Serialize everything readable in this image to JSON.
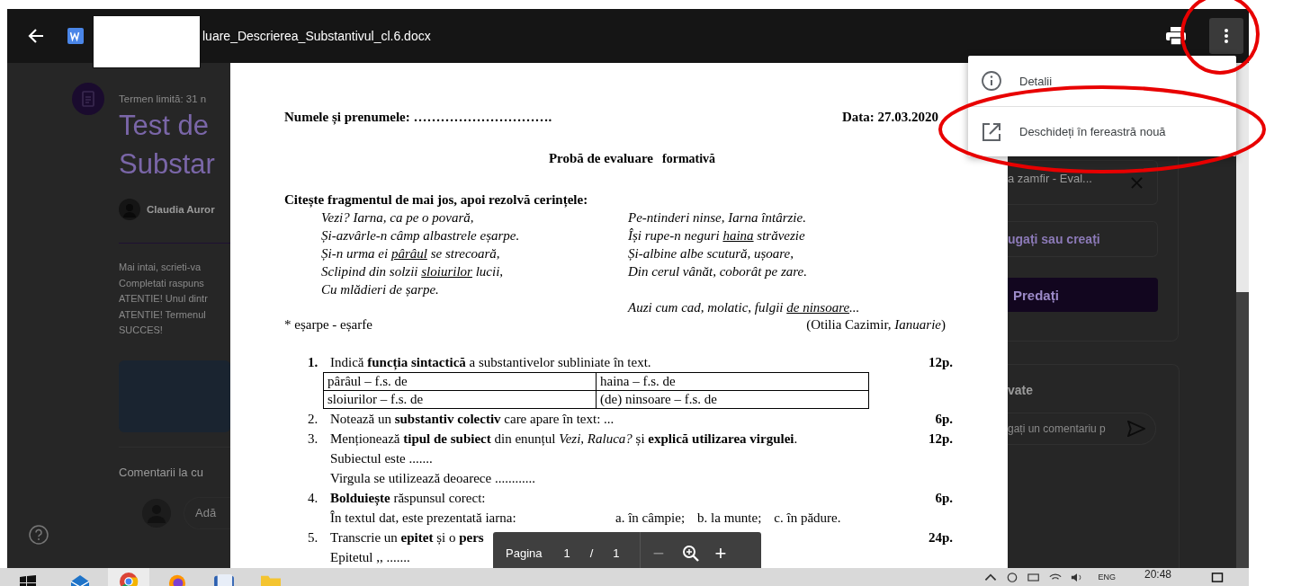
{
  "top_bar": {
    "title": "luare_Descrierea_Substantivul_cl.6.docx"
  },
  "background_page": {
    "due": "Termen limită: 31 n",
    "title_lines": [
      "Test de",
      "Substar"
    ],
    "author": "Claudia Auror",
    "description": [
      "Mai intai, scrieti-va",
      "Completati raspuns",
      "ATENTIE! Unul dintr",
      "ATENTIE! Termenul",
      "SUCCES!"
    ],
    "comments_heading": "Comentarii la cu",
    "comment_placeholder": "Adă",
    "attachment": "a zamfir - Eval...",
    "add_button": "ugați sau creați",
    "submit_button": "Predați",
    "private_heading": "vate",
    "private_placeholder": "gați un comentariu p"
  },
  "document": {
    "name_line": "Numele și prenumele: ………………………….",
    "date": "Data: 27.03.2020",
    "title": "Probă de evaluare",
    "subtitle": "formativă",
    "instruction": "Citește fragmentul de mai jos, apoi rezolvă cerințele:",
    "poem": [
      [
        {
          "text": "Vezi? Iarna, ca pe o povară,"
        },
        {
          "text": "Și-azvârle-n câmp albastrele eșarpe."
        },
        {
          "text": "Și-n urma ei ",
          "underlined": "pârâul",
          "after": " se strecoară,"
        },
        {
          "text": "Sclipind din solzii ",
          "underlined": "sloiurilor",
          "after": " lucii,"
        },
        {
          "text": "Cu mlădieri de șarpe."
        }
      ],
      [
        {
          "text": "Pe-ntinderi ninse, Iarna întârzie."
        },
        {
          "text": "Își rupe-n neguri ",
          "underlined": "haina",
          "after": " străvezie"
        },
        {
          "text": "Și-albine albe scutură, ușoare,"
        },
        {
          "text": "Din cerul vânăt, coborât pe zare."
        }
      ]
    ],
    "closing_line": {
      "text": "Auzi cum cad, molatic, fulgii ",
      "underlined": "de ninsoare",
      "after": "..."
    },
    "footnote": "* eșarpe - eșarfe",
    "source": "(Otilia Cazimir, *Ianuarie*)",
    "questions": [
      {
        "number": "1.",
        "number_bold": true,
        "text": "Indică **funcția sintactică** a substantivelor subliniate în text.",
        "points": "12p.",
        "table": [
          [
            "pârâul – f.s. de",
            "haina – f.s. de"
          ],
          [
            "sloiurilor – f.s. de",
            "(de) ninsoare – f.s. de"
          ]
        ]
      },
      {
        "number": "2.",
        "number_bold": false,
        "text": "Notează un **substantiv colectiv** care apare în text: ...",
        "points": "6p."
      },
      {
        "number": "3.",
        "number_bold": false,
        "text": "Menționează **tipul de subiect** din enunțul *Vezi, Raluca?* și **explică utilizarea virgulei**.",
        "points": "12p.",
        "lines": [
          "Subiectul este .......",
          "Virgula se utilizează deoarece ............"
        ]
      },
      {
        "number": "4.",
        "number_bold": false,
        "text": "**Bolduiește** răspunsul corect:",
        "points": "6p.",
        "options_line": {
          "text": "În textul dat, este prezentată iarna:",
          "options": [
            "a. în câmpie;",
            "b. la munte;",
            "c. în pădure."
          ]
        }
      },
      {
        "number": "5.",
        "number_bold": false,
        "text": "Transcrie un **epitet** și o **pers**",
        "points": "24p.",
        "lines": [
          "Epitetul ,, ......."
        ]
      }
    ]
  },
  "page_toolbar": {
    "label": "Pagina",
    "page": "1",
    "separator": "/",
    "total": "1",
    "zoom_out": "−",
    "zoom_in": "+"
  },
  "menu": {
    "items": [
      {
        "label": "Detalii",
        "kind": "info"
      },
      {
        "label": "Deschideți în fereastră nouă",
        "kind": "open"
      }
    ]
  },
  "taskbar": {
    "language": "ENG",
    "time": "20:48"
  }
}
